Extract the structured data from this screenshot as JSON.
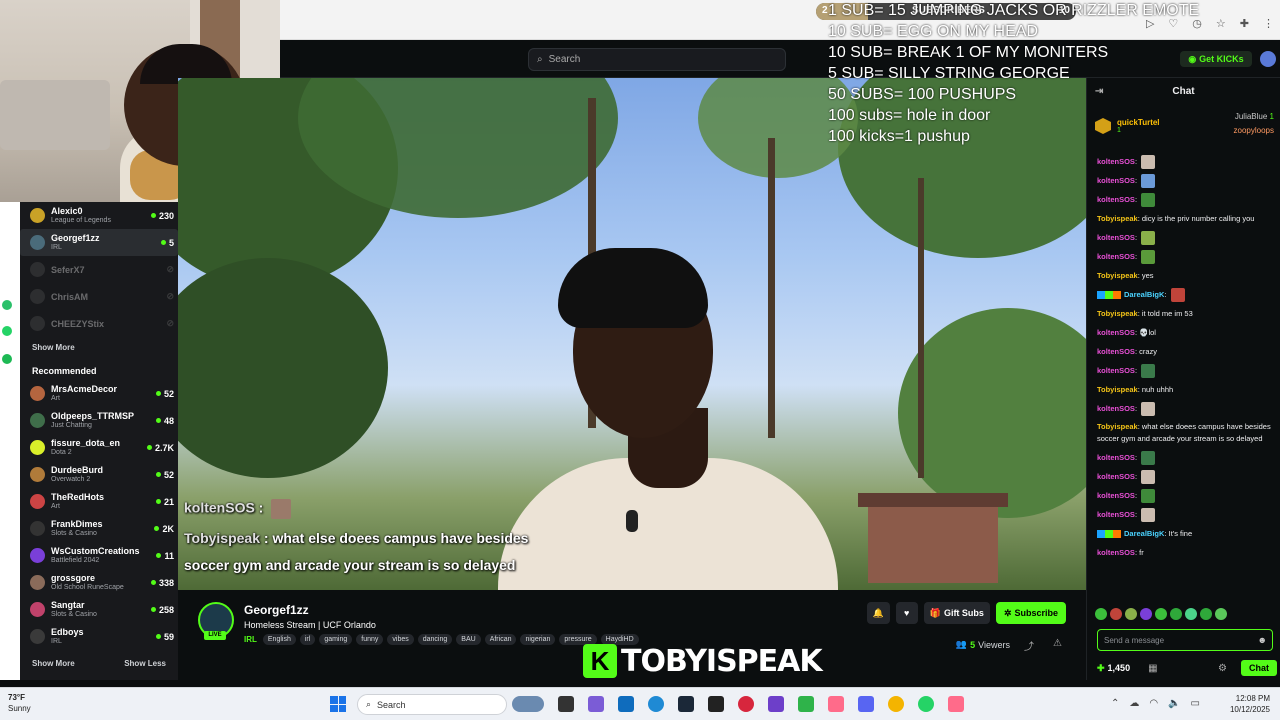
{
  "browser": {
    "subscribers_goal": {
      "label": "SUBSCRIBERS",
      "current": "2",
      "target": "10",
      "progress": 0.2
    }
  },
  "header": {
    "search_placeholder": "Search",
    "get_kicks": "Get KICKs"
  },
  "overlay_goals": [
    "1 SUB= 15 JUMPING JACKS OR RIZZLER EMOTE",
    "10 SUB= EGG ON MY HEAD",
    "10 SUB= BREAK 1 OF MY MONITERS",
    "5 SUB= SILLY STRING GEORGE",
    "50 SUBS= 100 PUSHUPS",
    "100 subs= hole in door",
    "100 kicks=1 pushup"
  ],
  "sidebar": {
    "following": [
      {
        "name": "Alexic0",
        "category": "League of Legends",
        "viewers": "230",
        "live": true,
        "color": "#c9a227"
      },
      {
        "name": "Georgef1zz",
        "category": "IRL",
        "viewers": "5",
        "live": true,
        "color": "#4a6b7a",
        "active": true
      },
      {
        "name": "SeferX7",
        "category": "",
        "viewers": "",
        "live": false,
        "color": "#555"
      },
      {
        "name": "ChrisAM",
        "category": "",
        "viewers": "",
        "live": false,
        "color": "#555"
      },
      {
        "name": "CHEEZYStix",
        "category": "",
        "viewers": "",
        "live": false,
        "color": "#555"
      }
    ],
    "show_more": "Show More",
    "recommended_heading": "Recommended",
    "recommended": [
      {
        "name": "MrsAcmeDecor",
        "category": "Art",
        "viewers": "52",
        "color": "#b5653f"
      },
      {
        "name": "Oldpeeps_TTRMSP",
        "category": "Just Chatting",
        "viewers": "48",
        "color": "#3f6e4a"
      },
      {
        "name": "fissure_dota_en",
        "category": "Dota 2",
        "viewers": "2.7K",
        "color": "#d9ef2a"
      },
      {
        "name": "DurdeeBurd",
        "category": "Overwatch 2",
        "viewers": "52",
        "color": "#b07b3a"
      },
      {
        "name": "TheRedHots",
        "category": "Art",
        "viewers": "21",
        "color": "#c44"
      },
      {
        "name": "FrankDimes",
        "category": "Slots & Casino",
        "viewers": "2K",
        "color": "#333"
      },
      {
        "name": "WsCustomCreations",
        "category": "Battlefield 2042",
        "viewers": "11",
        "color": "#7a3fd9"
      },
      {
        "name": "grossgore",
        "category": "Old School RuneScape",
        "viewers": "338",
        "color": "#8a6b5a"
      },
      {
        "name": "Sangtar",
        "category": "Slots & Casino",
        "viewers": "258",
        "color": "#c0426b"
      },
      {
        "name": "Edboys",
        "category": "IRL",
        "viewers": "59",
        "color": "#3a3a3a"
      }
    ],
    "show_more_bottom": "Show More",
    "show_less": "Show Less"
  },
  "video_overlay": {
    "line1_user": "koltenSOS",
    "line2_user": "Tobyispeak",
    "line2_text": "what else doees campus have besides",
    "line3_text": "soccer gym and arcade your stream is so delayed"
  },
  "stream": {
    "live_badge": "LIVE",
    "streamer": "Georgef1zz",
    "title": "Homeless Stream | UCF Orlando",
    "category": "IRL",
    "tags": [
      "English",
      "irl",
      "gaming",
      "funny",
      "vibes",
      "dancing",
      "BAU",
      "African",
      "nigerian",
      "pressure",
      "HaydiHD"
    ],
    "gift_subs": "Gift Subs",
    "subscribe": "Subscribe",
    "viewers_count": "5",
    "viewers_label": "Viewers",
    "watermark": "TOBYISPEAK"
  },
  "chat": {
    "title": "Chat",
    "pinned": {
      "name": "quickTurtel",
      "count": "1",
      "right1": "JuliaBlue",
      "right2": "zoopyloops",
      "right_count": "1"
    },
    "messages": [
      {
        "user": "koltenSOS",
        "text": "",
        "emote": "#cbbcb0",
        "ucls": "u-k"
      },
      {
        "user": "koltenSOS",
        "text": "",
        "emote": "#6b9ad8",
        "ucls": "u-k"
      },
      {
        "user": "koltenSOS",
        "text": "",
        "emote": "#3f8a3a",
        "ucls": "u-k"
      },
      {
        "user": "Tobyispeak",
        "text": "dicy is the priv number calling you",
        "ucls": "u-t"
      },
      {
        "user": "koltenSOS",
        "text": "",
        "emote": "#8ab04a",
        "ucls": "u-k"
      },
      {
        "user": "koltenSOS",
        "text": "",
        "emote": "#5a9a3a",
        "ucls": "u-k"
      },
      {
        "user": "Tobyispeak",
        "text": "yes",
        "ucls": "u-t"
      },
      {
        "user": "DarealBigK",
        "text": "",
        "emote": "#c0443a",
        "ucls": "u-d",
        "badges": true
      },
      {
        "user": "Tobyispeak",
        "text": "it told me im 53",
        "ucls": "u-t"
      },
      {
        "user": "koltenSOS",
        "text": "💀lol",
        "ucls": "u-k"
      },
      {
        "user": "koltenSOS",
        "text": "crazy",
        "ucls": "u-k"
      },
      {
        "user": "koltenSOS",
        "text": "",
        "emote": "#3a7a4a",
        "ucls": "u-k"
      },
      {
        "user": "Tobyispeak",
        "text": "nuh uhhh",
        "ucls": "u-t"
      },
      {
        "user": "koltenSOS",
        "text": "",
        "emote": "#cbbcb0",
        "ucls": "u-k"
      },
      {
        "user": "Tobyispeak",
        "text": "what else doees campus have besides soccer gym and arcade your stream is so delayed",
        "ucls": "u-t",
        "wrap": true
      },
      {
        "user": "koltenSOS",
        "text": "",
        "emote": "#3a7a4a",
        "ucls": "u-k"
      },
      {
        "user": "koltenSOS",
        "text": "",
        "emote": "#cbbcb0",
        "ucls": "u-k"
      },
      {
        "user": "koltenSOS",
        "text": "",
        "emote": "#3f8a3a",
        "ucls": "u-k"
      },
      {
        "user": "koltenSOS",
        "text": "",
        "emote": "#cbbcb0",
        "ucls": "u-k"
      },
      {
        "user": "DarealBigK",
        "text": "It's fine",
        "ucls": "u-d",
        "badges": true
      },
      {
        "user": "koltenSOS",
        "text": "fr",
        "ucls": "u-k"
      }
    ],
    "input_placeholder": "Send a message",
    "kicks_balance": "1,450",
    "send_button": "Chat"
  },
  "taskbar": {
    "temperature": "73°F",
    "condition": "Sunny",
    "search": "Search",
    "time": "12:08 PM",
    "date": "10/12/2025"
  },
  "colors": {
    "accent": "#53fc18",
    "background": "#0b0e0f",
    "sidebar": "#18191c"
  }
}
